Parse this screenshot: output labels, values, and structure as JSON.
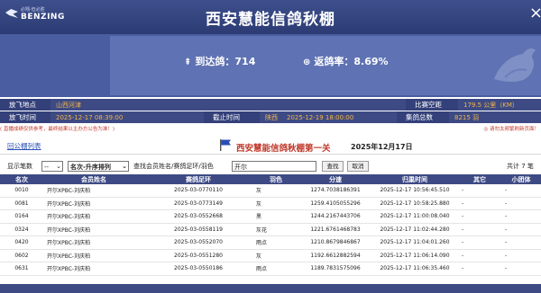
{
  "header": {
    "logo_cn": "必翔·但必胜",
    "logo_en": "BENZING",
    "title": "西安慧能信鸽秋棚",
    "close_label": "×"
  },
  "stats": {
    "arrived_label": "到达鸽：",
    "arrived_value": "714",
    "return_label": "返鸽率：",
    "return_value": "8.69%"
  },
  "info": {
    "release_place_label": "放飞地点",
    "release_place_value": "山西河津",
    "distance_label": "比赛空距",
    "distance_value": "179.5 公里（KM）",
    "release_time_label": "放飞时间",
    "release_time_value": "2025-12-17 08:39:00",
    "end_time_label": "截止时间",
    "end_time_region": "陕西",
    "end_time_value": "2025-12-19 18:00:00",
    "total_label": "集鸽总数",
    "total_value": "8215 羽"
  },
  "notice": {
    "left": "( 直播成绩仅供参考，最终结果以主办方公告为准！)",
    "right": "◎ 请勿太频繁刷新页面！"
  },
  "nav": {
    "back_link": "回公棚列表",
    "race_title": "西安慧能信鸽秋棚第一关",
    "race_date": "2025年12月17日"
  },
  "controls": {
    "show_label": "显示笔数",
    "show_value": "--",
    "sort_value": "名次-升序排列",
    "search_label": "查找会员姓名/赛鸽足环/羽色",
    "search_value": "开尔",
    "search_button": "查找",
    "cancel_button": "取消",
    "total_text": "共计 7 笔"
  },
  "table": {
    "headers": [
      "名次",
      "会员姓名",
      "赛鸽足环",
      "羽色",
      "分速",
      "归巢时间",
      "其它",
      "小团体"
    ],
    "rows": [
      [
        "0010",
        "开尔XPBC-刘庆柏",
        "2025-03-0770110",
        "灰",
        "1274.7038186391",
        "2025-12-17 10:56:45.510",
        "-",
        "-"
      ],
      [
        "0081",
        "开尔XPBC-刘庆柏",
        "2025-03-0773149",
        "灰",
        "1259.4105055296",
        "2025-12-17 10:58:25.880",
        "-",
        "-"
      ],
      [
        "0164",
        "开尔XPBC-刘庆柏",
        "2025-03-0552668",
        "黑",
        "1244.2167443706",
        "2025-12-17 11:00:08.040",
        "-",
        "-"
      ],
      [
        "0324",
        "开尔XPBC-刘庆柏",
        "2025-03-0558119",
        "灰花",
        "1221.6761468783",
        "2025-12-17 11:02:44.280",
        "-",
        "-"
      ],
      [
        "0420",
        "开尔XPBC-刘庆柏",
        "2025-03-0552070",
        "雨点",
        "1210.8679846867",
        "2025-12-17 11:04:01.260",
        "-",
        "-"
      ],
      [
        "0602",
        "开尔XPBC-刘庆柏",
        "2025-03-0551280",
        "灰",
        "1192.6612882594",
        "2025-12-17 11:06:14.090",
        "-",
        "-"
      ],
      [
        "0631",
        "开尔XPBC-刘庆柏",
        "2025-03-0550186",
        "雨点",
        "1189.7831575096",
        "2025-12-17 11:06:35.460",
        "-",
        "-"
      ]
    ]
  },
  "colors": {
    "header_bg": "#3d4f8c",
    "banner_bg": "#5f72b3",
    "accent_red": "#c0392b",
    "value_orange": "#f3b64b"
  }
}
